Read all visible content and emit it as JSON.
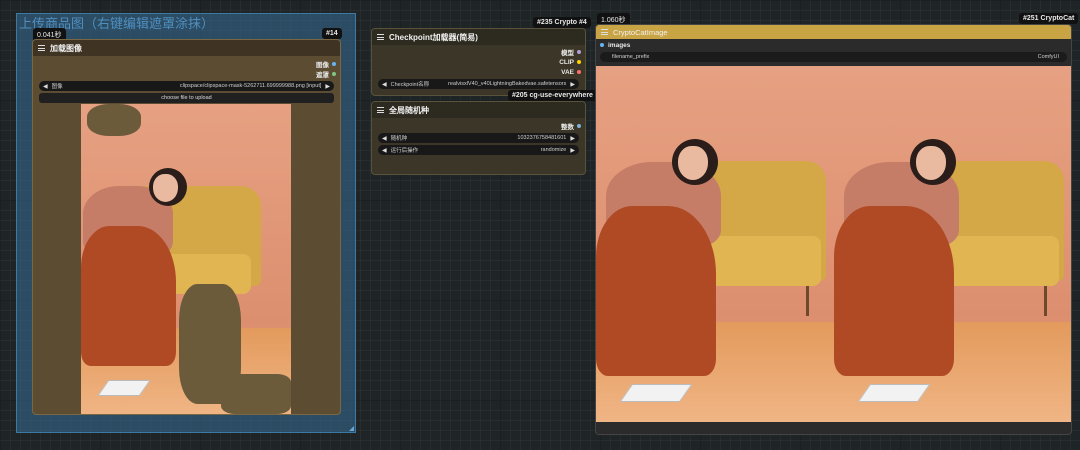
{
  "group": {
    "title": "上传商品图（右键编辑遮罩涂抹）"
  },
  "load_image": {
    "exec_time": "0.041秒",
    "id_badge": "#14",
    "title": "加载图像",
    "outputs": [
      {
        "label": "图像",
        "color": "#64b5f6"
      },
      {
        "label": "遮罩",
        "color": "#81c784"
      }
    ],
    "image_widget": {
      "label": "图像",
      "value": "clipspace/clipspace-mask-5262711.699999988.png [input]"
    },
    "upload_label": "choose file to upload"
  },
  "checkpoint": {
    "id_badge": "#235 Crypto  #4",
    "title": "Checkpoint加载器(简易)",
    "outputs": [
      {
        "label": "模型",
        "color": "#b39ddb"
      },
      {
        "label": "CLIP",
        "color": "#ffd500"
      },
      {
        "label": "VAE",
        "color": "#ff6e6e"
      }
    ],
    "widget": {
      "label": "Checkpoint名称",
      "value": "realvisxlV40_v40LightningBakedvae.safetensors"
    }
  },
  "seed": {
    "id_badge": "#205 cg-use-everywhere",
    "title": "全局随机种",
    "outputs": [
      {
        "label": "整数",
        "color": "#7fb2d9"
      }
    ],
    "widgets": [
      {
        "label": "随机种",
        "value": "1032376758481601"
      },
      {
        "label": "运行后操作",
        "value": "randomize"
      }
    ]
  },
  "crypto": {
    "exec_time": "1.060秒",
    "id_badge": "#251 CryptoCat",
    "title": "CryptoCatImage",
    "input_label": "images",
    "input_color": "#64b5f6",
    "prefix_label": "filename_prefix",
    "prefix_value": "ComfyUI"
  }
}
